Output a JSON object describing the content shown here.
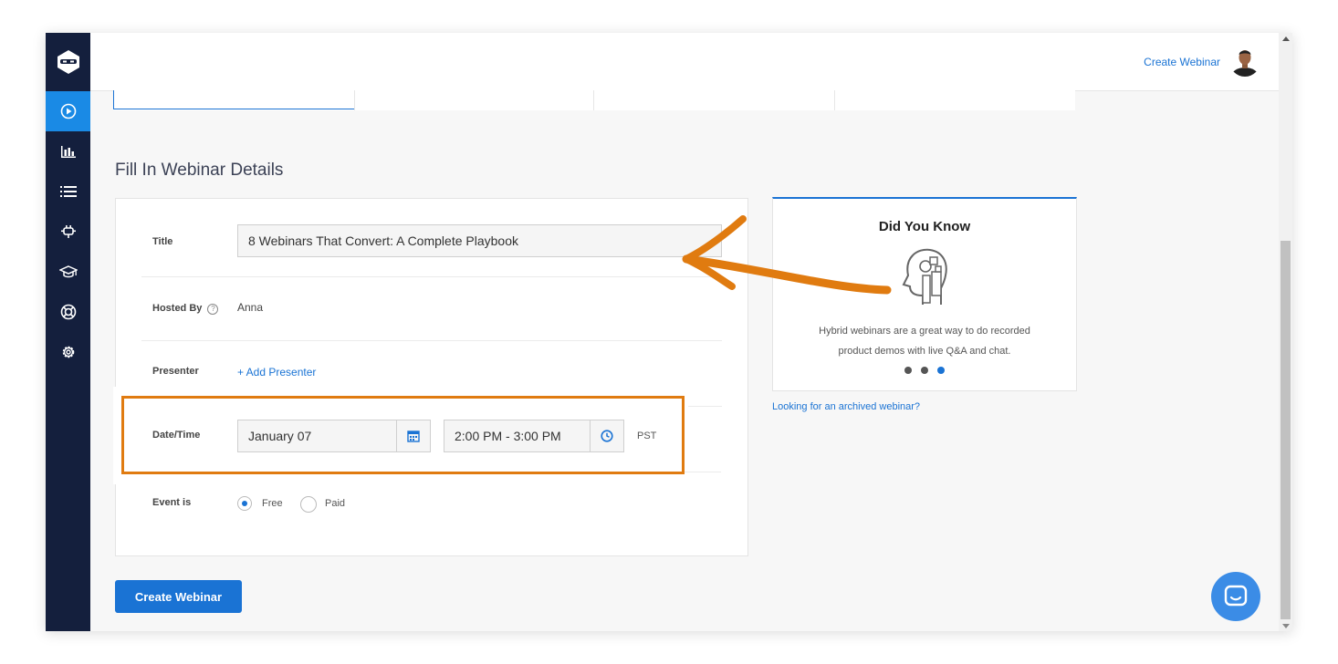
{
  "topbar": {
    "create_link": "Create Webinar"
  },
  "sidebar": {
    "items": [
      {
        "icon": "play-circle-icon",
        "active": true
      },
      {
        "icon": "bar-chart-icon",
        "active": false
      },
      {
        "icon": "list-icon",
        "active": false
      },
      {
        "icon": "plug-icon",
        "active": false
      },
      {
        "icon": "graduation-cap-icon",
        "active": false
      },
      {
        "icon": "lifebuoy-icon",
        "active": false
      },
      {
        "icon": "gear-icon",
        "active": false
      }
    ]
  },
  "page": {
    "section_title": "Fill In Webinar Details"
  },
  "form": {
    "title_label": "Title",
    "title_value": "8 Webinars That Convert: A Complete Playbook",
    "hosted_label": "Hosted By",
    "hosted_value": "Anna",
    "presenter_label": "Presenter",
    "add_presenter": "+ Add Presenter",
    "datetime_label": "Date/Time",
    "date_value": "January 07",
    "time_value": "2:00 PM - 3:00 PM",
    "timezone": "PST",
    "event_label": "Event is",
    "option_free": "Free",
    "option_paid": "Paid",
    "selected_option": "Free"
  },
  "did_you_know": {
    "title": "Did You Know",
    "text_line1": "Hybrid webinars are a great way to do recorded",
    "text_line2": "product demos with live Q&A and chat.",
    "dots": 3,
    "active_dot": 3
  },
  "archive_link": "Looking for an archived webinar?",
  "create_button": "Create Webinar",
  "colors": {
    "accent": "#1a73d4",
    "sidebar": "#141f3d",
    "highlight": "#e07b10"
  }
}
